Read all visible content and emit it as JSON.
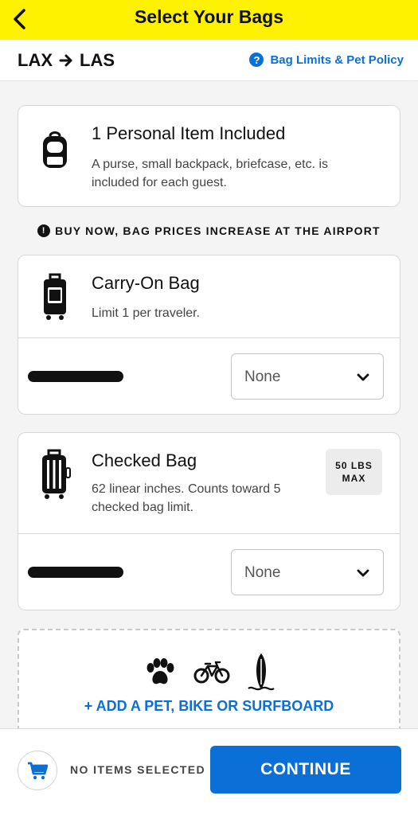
{
  "header": {
    "title": "Select Your Bags",
    "back_icon": "chevron-left-icon"
  },
  "route": {
    "origin": "LAX",
    "destination": "LAS",
    "arrow_icon": "arrow-right-icon"
  },
  "policy_link": {
    "label": "Bag Limits & Pet Policy",
    "icon": "question-circle-icon"
  },
  "personal_item": {
    "title": "1 Personal Item Included",
    "description": "A purse, small backpack, briefcase, etc. is included for each guest.",
    "icon": "backpack-icon"
  },
  "notice": {
    "text": "BUY NOW, BAG PRICES INCREASE AT THE AIRPORT",
    "icon": "exclamation-circle-icon"
  },
  "carry_on": {
    "title": "Carry-On Bag",
    "description": "Limit 1 per traveler.",
    "icon": "carry-on-suitcase-icon",
    "select_value": "None"
  },
  "checked_bag": {
    "title": "Checked Bag",
    "description": "62 linear inches. Counts toward 5 checked bag limit.",
    "icon": "checked-suitcase-icon",
    "badge_line1": "50 LBS",
    "badge_line2": "MAX",
    "select_value": "None"
  },
  "addons": {
    "label": "+ ADD A PET, BIKE OR SURFBOARD",
    "icons": [
      "paw-icon",
      "bicycle-icon",
      "surfboard-icon"
    ]
  },
  "footer": {
    "status": "NO ITEMS SELECTED",
    "cta": "CONTINUE",
    "cart_icon": "cart-icon"
  },
  "colors": {
    "header_bg": "#fff200",
    "accent": "#0b6fd8",
    "page_bg": "#f4f4f4"
  }
}
